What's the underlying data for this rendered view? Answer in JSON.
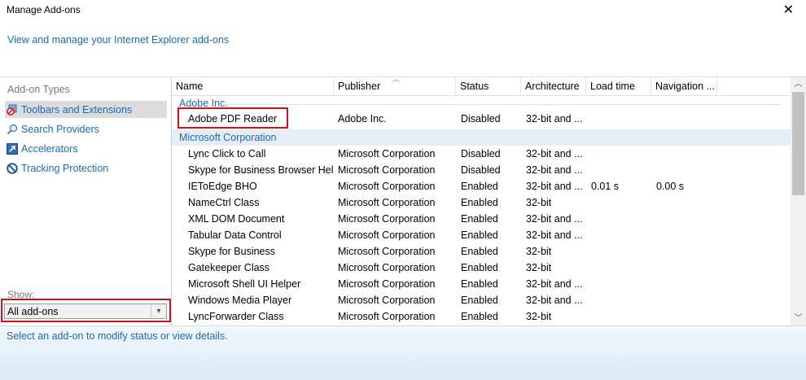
{
  "window": {
    "title": "Manage Add-ons"
  },
  "subtitle": "View and manage your Internet Explorer add-ons",
  "sidebar": {
    "types_label": "Add-on Types",
    "items": [
      {
        "label": "Toolbars and Extensions",
        "icon": "toolbars-icon",
        "selected": true
      },
      {
        "label": "Search Providers",
        "icon": "search-icon",
        "selected": false
      },
      {
        "label": "Accelerators",
        "icon": "accelerator-icon",
        "selected": false
      },
      {
        "label": "Tracking Protection",
        "icon": "tracking-protection-icon",
        "selected": false
      }
    ],
    "show_label": "Show:",
    "show_value": "All add-ons"
  },
  "table": {
    "columns": [
      "Name",
      "Publisher",
      "Status",
      "Architecture",
      "Load time",
      "Navigation ..."
    ],
    "groups": [
      {
        "name": "Adobe Inc.",
        "rows": [
          {
            "name": "Adobe PDF Reader",
            "publisher": "Adobe Inc.",
            "status": "Disabled",
            "arch": "32-bit and ...",
            "load": "",
            "nav": ""
          }
        ]
      },
      {
        "name": "Microsoft Corporation",
        "rows": [
          {
            "name": "Lync Click to Call",
            "publisher": "Microsoft Corporation",
            "status": "Disabled",
            "arch": "32-bit and ...",
            "load": "",
            "nav": ""
          },
          {
            "name": "Skype for Business Browser Hel...",
            "publisher": "Microsoft Corporation",
            "status": "Disabled",
            "arch": "32-bit and ...",
            "load": "",
            "nav": ""
          },
          {
            "name": "IEToEdge BHO",
            "publisher": "Microsoft Corporation",
            "status": "Enabled",
            "arch": "32-bit and ...",
            "load": "0.01 s",
            "nav": "0.00 s"
          },
          {
            "name": "NameCtrl Class",
            "publisher": "Microsoft Corporation",
            "status": "Enabled",
            "arch": "32-bit",
            "load": "",
            "nav": ""
          },
          {
            "name": "XML DOM Document",
            "publisher": "Microsoft Corporation",
            "status": "Enabled",
            "arch": "32-bit and ...",
            "load": "",
            "nav": ""
          },
          {
            "name": "Tabular Data Control",
            "publisher": "Microsoft Corporation",
            "status": "Enabled",
            "arch": "32-bit and ...",
            "load": "",
            "nav": ""
          },
          {
            "name": "Skype for Business",
            "publisher": "Microsoft Corporation",
            "status": "Enabled",
            "arch": "32-bit",
            "load": "",
            "nav": ""
          },
          {
            "name": "Gatekeeper Class",
            "publisher": "Microsoft Corporation",
            "status": "Enabled",
            "arch": "32-bit",
            "load": "",
            "nav": ""
          },
          {
            "name": "Microsoft Shell UI Helper",
            "publisher": "Microsoft Corporation",
            "status": "Enabled",
            "arch": "32-bit and ...",
            "load": "",
            "nav": ""
          },
          {
            "name": "Windows Media Player",
            "publisher": "Microsoft Corporation",
            "status": "Enabled",
            "arch": "32-bit and ...",
            "load": "",
            "nav": ""
          },
          {
            "name": "LyncForwarder Class",
            "publisher": "Microsoft Corporation",
            "status": "Enabled",
            "arch": "32-bit",
            "load": "",
            "nav": ""
          }
        ]
      }
    ]
  },
  "footer": {
    "message": "Select an add-on to modify status or view details."
  },
  "colors": {
    "link": "#1a6bb5",
    "highlight": "#d0111b",
    "selected_bg": "#dcdcdc"
  }
}
